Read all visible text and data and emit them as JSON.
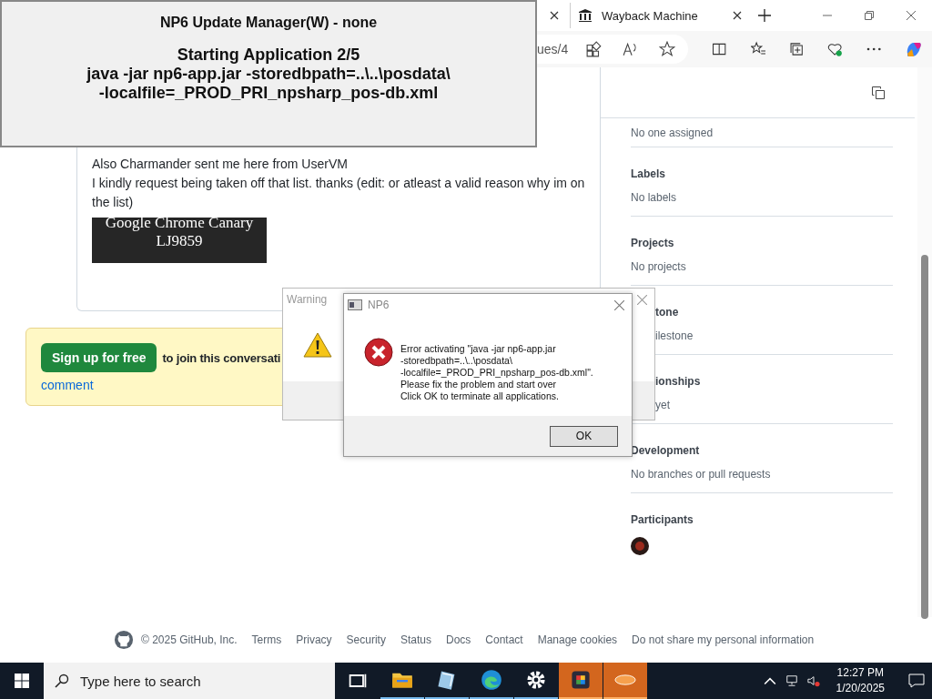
{
  "update_manager": {
    "title": "NP6 Update Manager(W) - none",
    "status": "Starting Application 2/5",
    "command_lines": [
      "java -jar np6-app.jar -storedbpath=..\\..\\posdata\\",
      "-localfile=_PROD_PRI_npsharp_pos-db.xml"
    ]
  },
  "browser": {
    "tabs": [
      {
        "label": "Wayback Machine"
      }
    ],
    "address": "ues/4"
  },
  "comment": {
    "lines": [
      "Also Charmander sent me here from UserVM",
      "I kindly request being taken off that list. thanks (edit: or atleast a valid reason why im on the list)"
    ],
    "image_lines": [
      "Google Chrome Canary",
      "LJ9859"
    ]
  },
  "signup": {
    "button": "Sign up for free",
    "text": "to join this conversati",
    "link": "comment"
  },
  "sidebar": {
    "sections": [
      {
        "value": "No one assigned",
        "partial": false
      },
      {
        "heading": "Labels",
        "value": "No labels",
        "partial": false
      },
      {
        "heading": "Projects",
        "value": "No projects",
        "partial": false
      },
      {
        "heading": "tone",
        "value": "ilestone",
        "partial": true
      },
      {
        "heading": "ionships",
        "value": "yet",
        "partial": true
      },
      {
        "heading": "Development",
        "value": "No branches or pull requests",
        "partial": false
      },
      {
        "heading": "Participants",
        "avatars": [
          {
            "kind": "avatar"
          }
        ],
        "partial": false
      }
    ]
  },
  "footer": {
    "copyright": "© 2025 GitHub, Inc.",
    "links": [
      "Terms",
      "Privacy",
      "Security",
      "Status",
      "Docs",
      "Contact",
      "Manage cookies",
      "Do not share my personal information"
    ]
  },
  "warning_dialog": {
    "title": "Warning"
  },
  "error_dialog": {
    "title": "NP6",
    "message_lines": [
      "Error activating \"java -jar np6-app.jar",
      "-storedbpath=..\\..\\posdata\\",
      "-localfile=_PROD_PRI_npsharp_pos-db.xml\".",
      "Please fix the problem and start over",
      "Click OK to terminate all applications."
    ],
    "button": "OK"
  },
  "taskbar": {
    "search": {
      "placeholder": "Type here to search"
    },
    "apps": [
      {
        "kind": "taskview",
        "running": false,
        "flashing": false
      },
      {
        "kind": "explorer",
        "running": true,
        "flashing": false
      },
      {
        "kind": "notepad",
        "running": true,
        "flashing": false
      },
      {
        "kind": "edge",
        "running": true,
        "flashing": false
      },
      {
        "kind": "settings",
        "running": true,
        "flashing": false
      },
      {
        "kind": "puzzle",
        "running": true,
        "flashing": true
      },
      {
        "kind": "np6",
        "running": true,
        "flashing": true
      }
    ],
    "time": "12:27 PM",
    "date": "1/20/2025"
  }
}
